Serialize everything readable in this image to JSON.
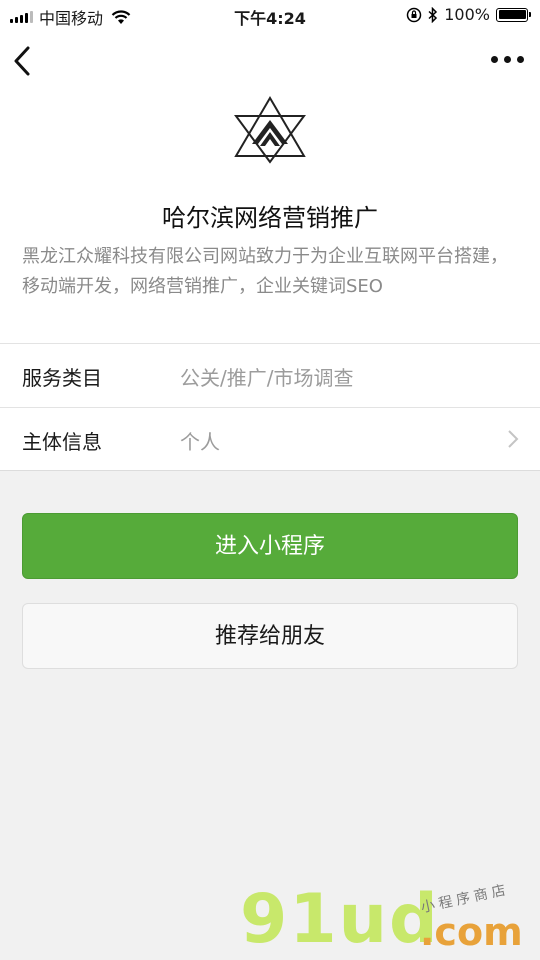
{
  "status_bar": {
    "carrier": "中国移动",
    "time": "下午4:24",
    "battery": "100%"
  },
  "app": {
    "name": "哈尔滨网络营销推广",
    "description": "黑龙江众耀科技有限公司网站致力于为企业互联网平台搭建，移动端开发，网络营销推广，企业关键词SEO"
  },
  "info_rows": [
    {
      "label": "服务类目",
      "value": "公关/推广/市场调查"
    },
    {
      "label": "主体信息",
      "value": "个人"
    }
  ],
  "buttons": {
    "enter": "进入小程序",
    "share": "推荐给朋友"
  },
  "watermark": {
    "main": "91ud",
    "domain": ".com",
    "tagline": "小程序商店"
  },
  "colors": {
    "primary_green": "#56ab3a",
    "watermark_green": "#c8e86b",
    "watermark_orange": "#e8a23a"
  }
}
